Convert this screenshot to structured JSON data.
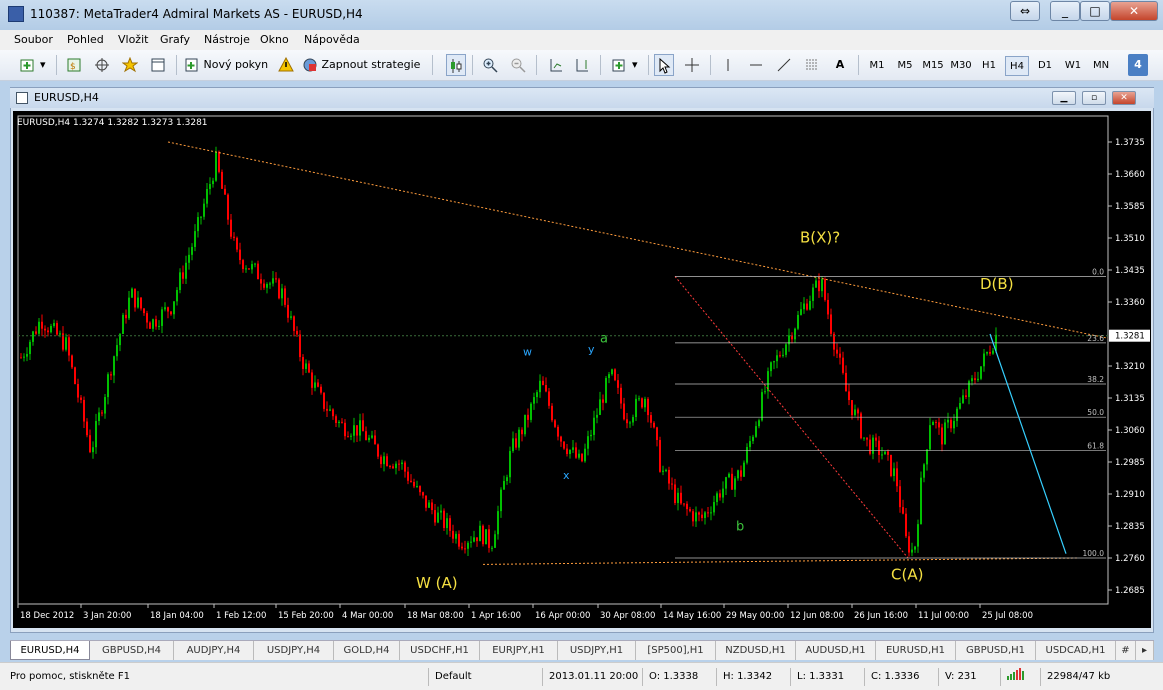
{
  "window": {
    "title": "110387: MetaTrader4 Admiral Markets AS - EURUSD,H4",
    "minimize": "_",
    "maximize": "□",
    "close": "✕",
    "restore": "⇔"
  },
  "menu": [
    "Soubor",
    "Pohled",
    "Vložit",
    "Grafy",
    "Nástroje",
    "Okno",
    "Nápověda"
  ],
  "toolbar": {
    "new_order": "Nový pokyn",
    "autotrading": "Zapnout strategie",
    "text_tool": "A",
    "timeframes": [
      "M1",
      "M5",
      "M15",
      "M30",
      "H1",
      "H4",
      "D1",
      "W1",
      "MN"
    ],
    "active_timeframe": "H4",
    "badge": "4"
  },
  "chart_window": {
    "title": "EURUSD,H4",
    "info": "EURUSD,H4  1.3274 1.3282 1.3273 1.3281"
  },
  "chart_data": {
    "type": "candlestick",
    "symbol": "EURUSD",
    "timeframe": "H4",
    "ohlc_last": {
      "open": 1.3274,
      "high": 1.3282,
      "low": 1.3273,
      "close": 1.3281
    },
    "ylim": [
      1.2685,
      1.3735
    ],
    "y_ticks": [
      "1.3735",
      "1.3660",
      "1.3585",
      "1.3510",
      "1.3435",
      "1.3360",
      "1.3210",
      "1.3135",
      "1.3060",
      "1.2985",
      "1.2910",
      "1.2835",
      "1.2760",
      "1.2685"
    ],
    "current_price": "1.3281",
    "x_ticks": [
      "18 Dec 2012",
      "3 Jan 20:00",
      "18 Jan 04:00",
      "1 Feb 12:00",
      "15 Feb 20:00",
      "4 Mar 00:00",
      "18 Mar 08:00",
      "1 Apr 16:00",
      "16 Apr 00:00",
      "30 Apr 08:00",
      "14 May 16:00",
      "29 May 00:00",
      "12 Jun 08:00",
      "26 Jun 16:00",
      "11 Jul 00:00",
      "25 Jul 08:00"
    ],
    "fib_levels": [
      "0.0",
      "23.6",
      "38.2",
      "50.0",
      "61.8",
      "100.0"
    ],
    "annotations": [
      "B(X)?",
      "D(B)",
      "C(A)",
      "W (A)",
      "w",
      "y",
      "x",
      "a",
      "b"
    ],
    "colors": {
      "background": "#000000",
      "bull": "#00c000",
      "bear": "#ff0000",
      "trendline": "#ff9c3c",
      "projection": "#36d0ff",
      "label": "#f5e042",
      "green_label": "#3cc23c",
      "blue_label": "#2aa7ff",
      "fib": "#c0c0c0"
    }
  },
  "tabs": [
    "EURUSD,H4",
    "GBPUSD,H4",
    "AUDJPY,H4",
    "USDJPY,H4",
    "GOLD,H4",
    "USDCHF,H1",
    "EURJPY,H1",
    "USDJPY,H1",
    "[SP500],H1",
    "NZDUSD,H1",
    "AUDUSD,H1",
    "EURUSD,H1",
    "GBPUSD,H1",
    "USDCAD,H1",
    "#"
  ],
  "status": {
    "help": "Pro pomoc, stiskněte F1",
    "profile": "Default",
    "time": "2013.01.11 20:00",
    "open": "O: 1.3338",
    "high": "H: 1.3342",
    "low": "L: 1.3331",
    "close": "C: 1.3336",
    "volume": "V: 231",
    "traffic": "22984/47 kb"
  }
}
